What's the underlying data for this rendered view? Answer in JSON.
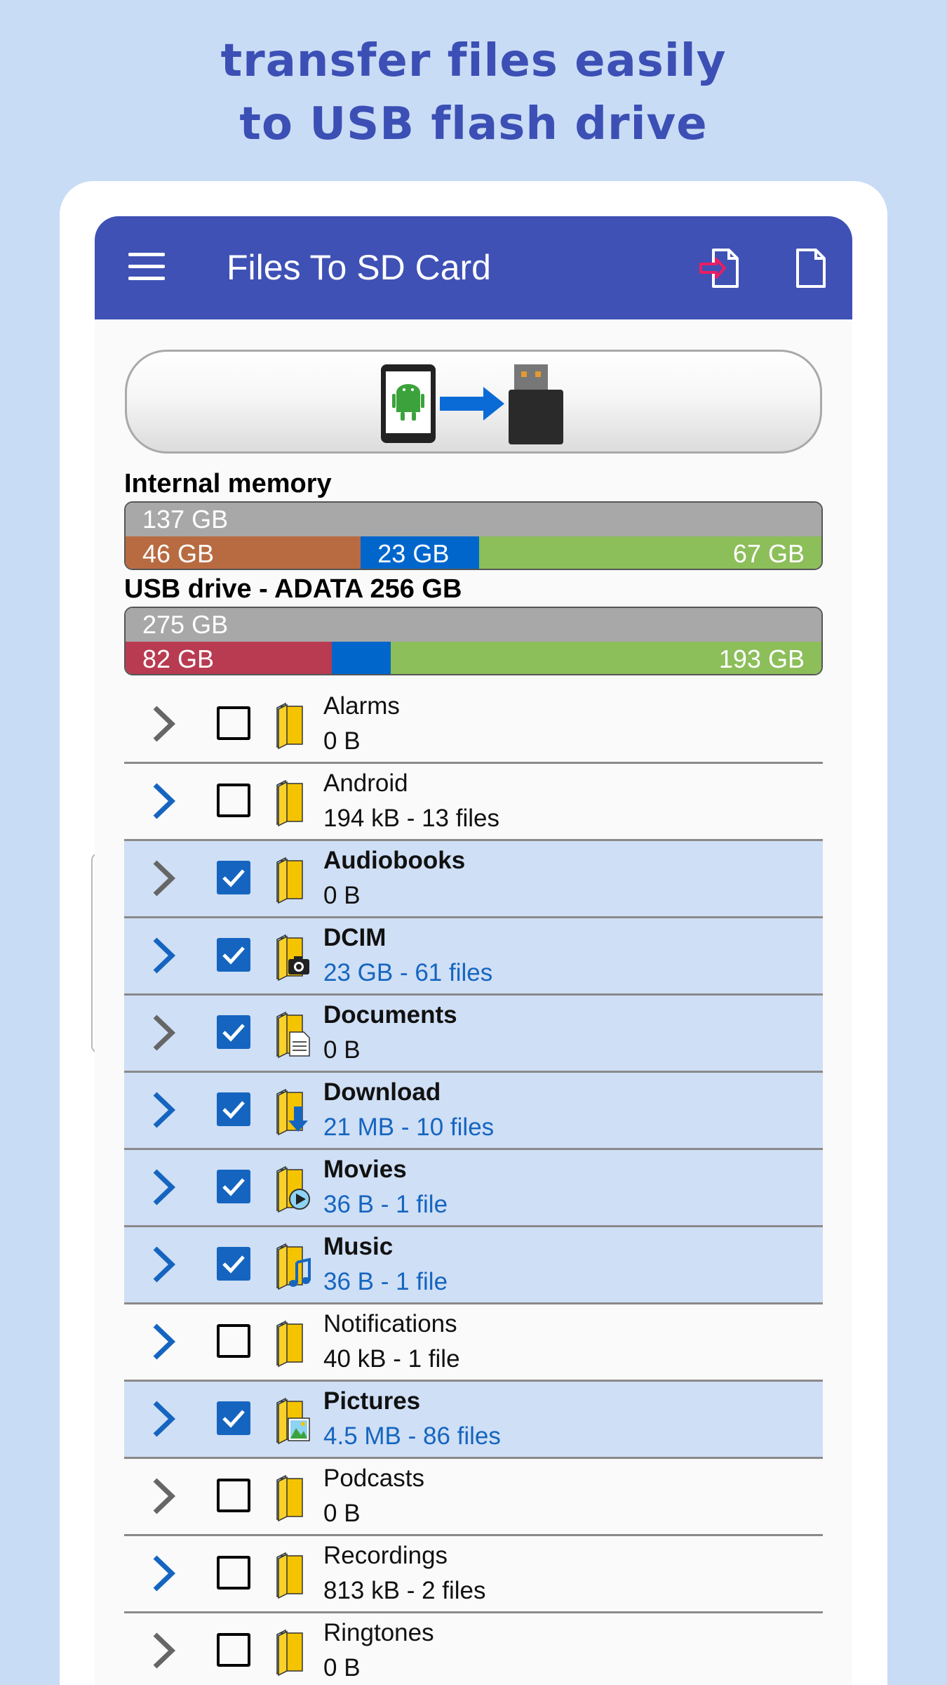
{
  "promo": {
    "line1": "transfer files easily",
    "line2": "to USB flash drive"
  },
  "app": {
    "title": "Files To SD Card"
  },
  "colors": {
    "appbar": "#3f51b5",
    "promo_text": "#3b4fb5",
    "background": "#c9dcf5",
    "selected_row": "#cfdff5",
    "accent_blue": "#1565c0",
    "used_internal": "#b86b41",
    "used_usb": "#b83b51",
    "selected_size": "#0066cc",
    "free": "#8cbe5a",
    "total": "#a8a8a8"
  },
  "storage": {
    "internal": {
      "label": "Internal memory",
      "total": "137 GB",
      "used": "46 GB",
      "selected": "23 GB",
      "free": "67 GB",
      "used_fraction": 0.338,
      "selected_fraction": 0.17,
      "free_fraction": 0.492
    },
    "usb": {
      "label": "USB drive - ADATA 256 GB",
      "total": "275 GB",
      "used": "82 GB",
      "selected": "",
      "free": "193 GB",
      "used_fraction": 0.296,
      "selected_fraction": 0.085,
      "free_fraction": 0.619
    }
  },
  "folders": [
    {
      "name": "Alarms",
      "info": "0 B",
      "checked": false,
      "expandable": false,
      "icon": "folder-icon"
    },
    {
      "name": "Android",
      "info": "194 kB - 13 files",
      "checked": false,
      "expandable": true,
      "icon": "folder-icon"
    },
    {
      "name": "Audiobooks",
      "info": "0 B",
      "checked": true,
      "expandable": false,
      "icon": "folder-icon"
    },
    {
      "name": "DCIM",
      "info": "23 GB - 61 files",
      "checked": true,
      "expandable": true,
      "icon": "camera-folder-icon"
    },
    {
      "name": "Documents",
      "info": "0 B",
      "checked": true,
      "expandable": false,
      "icon": "document-folder-icon"
    },
    {
      "name": "Download",
      "info": "21 MB - 10 files",
      "checked": true,
      "expandable": true,
      "icon": "download-folder-icon"
    },
    {
      "name": "Movies",
      "info": "36 B - 1 file",
      "checked": true,
      "expandable": true,
      "icon": "movie-folder-icon"
    },
    {
      "name": "Music",
      "info": "36 B - 1 file",
      "checked": true,
      "expandable": true,
      "icon": "music-folder-icon"
    },
    {
      "name": "Notifications",
      "info": "40 kB - 1 file",
      "checked": false,
      "expandable": true,
      "icon": "folder-icon"
    },
    {
      "name": "Pictures",
      "info": "4.5 MB - 86 files",
      "checked": true,
      "expandable": true,
      "icon": "picture-folder-icon"
    },
    {
      "name": "Podcasts",
      "info": "0 B",
      "checked": false,
      "expandable": false,
      "icon": "folder-icon"
    },
    {
      "name": "Recordings",
      "info": "813 kB - 2 files",
      "checked": false,
      "expandable": true,
      "icon": "folder-icon"
    },
    {
      "name": "Ringtones",
      "info": "0 B",
      "checked": false,
      "expandable": false,
      "icon": "folder-icon"
    }
  ]
}
